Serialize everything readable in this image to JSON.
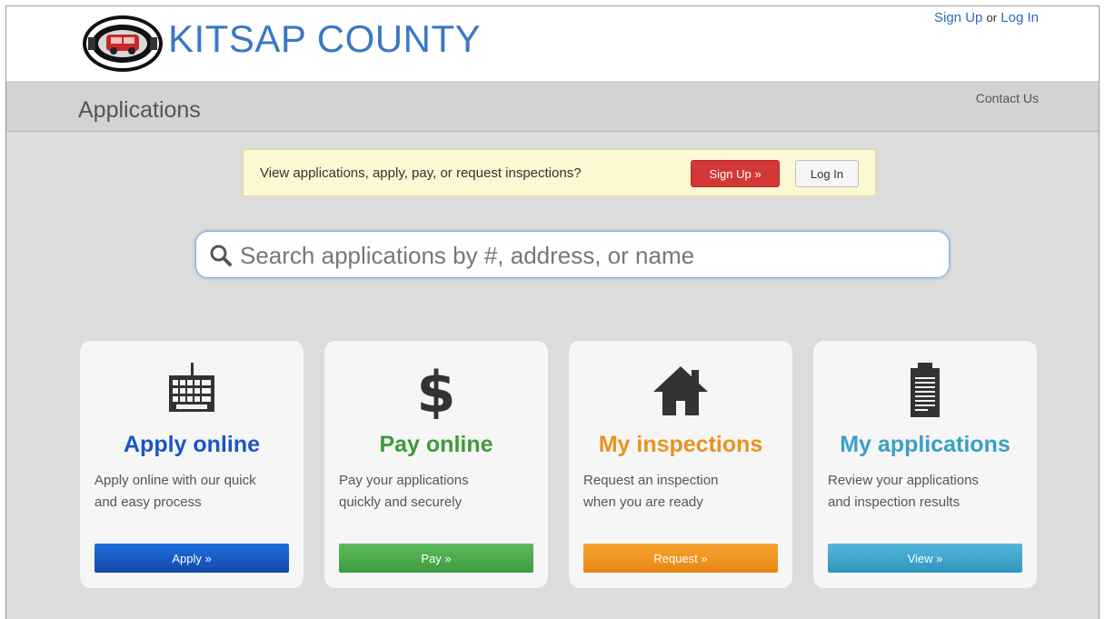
{
  "header": {
    "brand": "KITSAP COUNTY",
    "sign_up": "Sign Up",
    "or": "or",
    "log_in": "Log In"
  },
  "subheader": {
    "title": "Applications",
    "contact": "Contact Us"
  },
  "notice": {
    "text": "View applications, apply, pay, or request inspections?",
    "sign_up_button": "Sign Up »",
    "log_in_button": "Log In"
  },
  "search": {
    "placeholder": "Search applications by #, address, or name"
  },
  "cards": [
    {
      "icon": "keyboard-icon",
      "title": "Apply online",
      "desc_line1": "Apply online with our quick",
      "desc_line2": "and easy process",
      "button": "Apply »",
      "color": "#1a56c4"
    },
    {
      "icon": "dollar-icon",
      "title": "Pay online",
      "desc_line1": "Pay your applications",
      "desc_line2": "quickly and securely",
      "button": "Pay »",
      "color": "#3f9a37"
    },
    {
      "icon": "house-icon",
      "title": "My inspections",
      "desc_line1": "Request an inspection",
      "desc_line2": "when you are ready",
      "button": "Request »",
      "color": "#e8931f"
    },
    {
      "icon": "clipboard-icon",
      "title": "My applications",
      "desc_line1": "Review your applications",
      "desc_line2": "and inspection results",
      "button": "View »",
      "color": "#3aa0c6"
    }
  ],
  "colors": {
    "brand": "#3b78c4",
    "apply_btn": "#1f5fc9",
    "pay_btn": "#4cae4c",
    "request_btn": "#f0951e",
    "view_btn": "#43a9cf",
    "signup_btn": "#d23838"
  }
}
